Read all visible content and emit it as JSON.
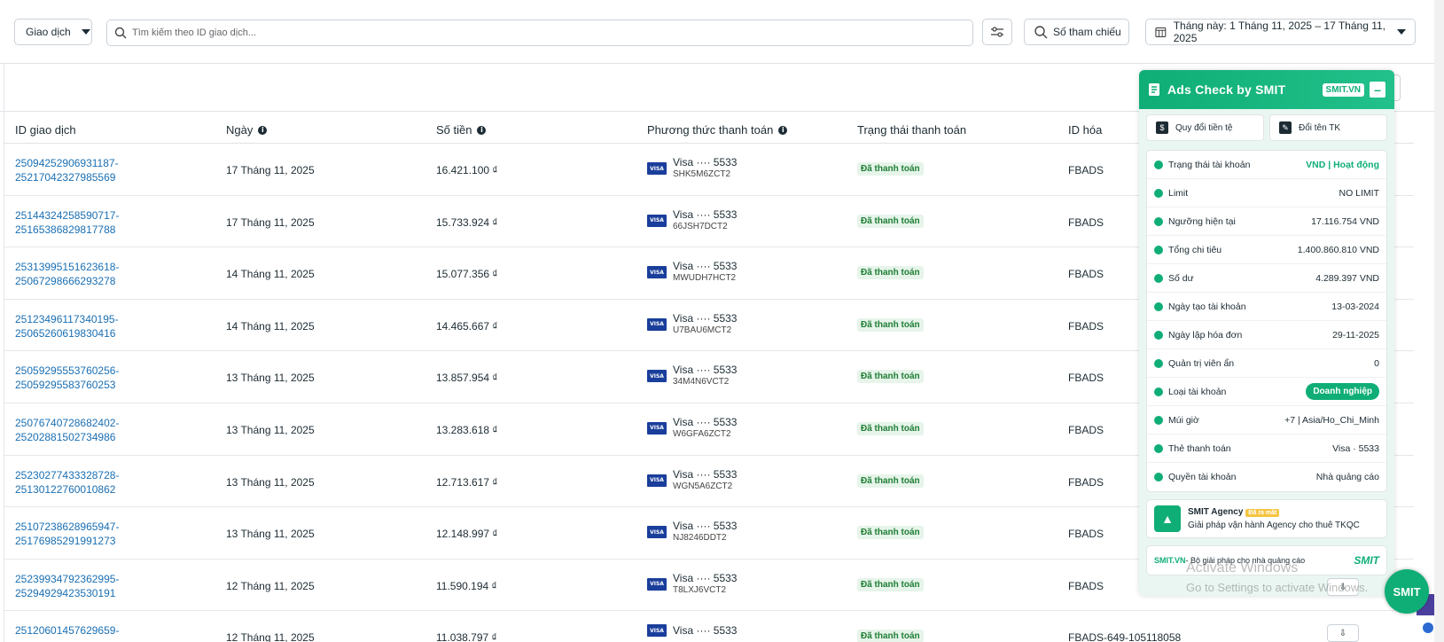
{
  "filters": {
    "type_label": "Giao dịch",
    "search_placeholder": "Tìm kiếm theo ID giao dịch...",
    "reference_label": "Số tham chiếu",
    "date_range_label": "Tháng này: 1 Tháng 11, 2025 – 17 Tháng 11, 2025"
  },
  "table": {
    "headers": {
      "id": "ID giao dịch",
      "date": "Ngày",
      "amount": "Số tiền",
      "payment": "Phương thức thanh toán",
      "status": "Trạng thái thanh toán",
      "invoice": "ID hóa"
    },
    "rows": [
      {
        "id1": "25094252906931187-",
        "id2": "25217042327985569",
        "date": "17 Tháng 11, 2025",
        "amount": "16.421.100 ₫",
        "card": "Visa ···· 5533",
        "code": "SHK5M6ZCT2",
        "status": "Đã thanh toán",
        "invoice": "FBADS"
      },
      {
        "id1": "25144324258590717-",
        "id2": "25165386829817788",
        "date": "17 Tháng 11, 2025",
        "amount": "15.733.924 ₫",
        "card": "Visa ···· 5533",
        "code": "66JSH7DCT2",
        "status": "Đã thanh toán",
        "invoice": "FBADS"
      },
      {
        "id1": "25313995151623618-",
        "id2": "25067298666293278",
        "date": "14 Tháng 11, 2025",
        "amount": "15.077.356 ₫",
        "card": "Visa ···· 5533",
        "code": "MWUDH7HCT2",
        "status": "Đã thanh toán",
        "invoice": "FBADS"
      },
      {
        "id1": "25123496117340195-",
        "id2": "25065260619830416",
        "date": "14 Tháng 11, 2025",
        "amount": "14.465.667 ₫",
        "card": "Visa ···· 5533",
        "code": "U7BAU6MCT2",
        "status": "Đã thanh toán",
        "invoice": "FBADS"
      },
      {
        "id1": "25059295553760256-",
        "id2": "25059295583760253",
        "date": "13 Tháng 11, 2025",
        "amount": "13.857.954 ₫",
        "card": "Visa ···· 5533",
        "code": "34M4N6VCT2",
        "status": "Đã thanh toán",
        "invoice": "FBADS"
      },
      {
        "id1": "25076740728682402-",
        "id2": "25202881502734986",
        "date": "13 Tháng 11, 2025",
        "amount": "13.283.618 ₫",
        "card": "Visa ···· 5533",
        "code": "W6GFA6ZCT2",
        "status": "Đã thanh toán",
        "invoice": "FBADS"
      },
      {
        "id1": "25230277433328728-",
        "id2": "25130122760010862",
        "date": "13 Tháng 11, 2025",
        "amount": "12.713.617 ₫",
        "card": "Visa ···· 5533",
        "code": "WGN5A6ZCT2",
        "status": "Đã thanh toán",
        "invoice": "FBADS"
      },
      {
        "id1": "25107238628965947-",
        "id2": "25176985291991273",
        "date": "13 Tháng 11, 2025",
        "amount": "12.148.997 ₫",
        "card": "Visa ···· 5533",
        "code": "NJ8246DDT2",
        "status": "Đã thanh toán",
        "invoice": "FBADS"
      },
      {
        "id1": "25239934792362995-",
        "id2": "25294929423530191",
        "date": "12 Tháng 11, 2025",
        "amount": "11.590.194 ₫",
        "card": "Visa ···· 5533",
        "code": "T8LXJ6VCT2",
        "status": "Đã thanh toán",
        "invoice": "FBADS"
      },
      {
        "id1": "25120601457629659-",
        "id2": "",
        "date": "12 Tháng 11, 2025",
        "amount": "11.038.797 ₫",
        "card": "Visa ···· 5533",
        "code": "",
        "status": "Đã thanh toán",
        "invoice": "FBADS-649-105118058"
      }
    ]
  },
  "panel": {
    "title": "Ads Check by SMIT",
    "badge": "SMIT.VN",
    "minimize": "–",
    "btn_currency": "Quy đổi tiền tệ",
    "btn_rename": "Đổi tên TK",
    "fields": [
      {
        "label": "Trạng thái tài khoản",
        "value": "VND | Hoạt động"
      },
      {
        "label": "Limit",
        "value": "NO LIMIT"
      },
      {
        "label": "Ngưỡng hiện tại",
        "value": "17.116.754 VND"
      },
      {
        "label": "Tổng chi tiêu",
        "value": "1.400.860.810 VND"
      },
      {
        "label": "Số dư",
        "value": "4.289.397 VND"
      },
      {
        "label": "Ngày tạo tài khoản",
        "value": "13-03-2024"
      },
      {
        "label": "Ngày lập hóa đơn",
        "value": "29-11-2025"
      },
      {
        "label": "Quản trị viên ẩn",
        "value": "0"
      },
      {
        "label": "Loại tài khoản",
        "value": "Doanh nghiệp"
      },
      {
        "label": "Múi giờ",
        "value": "+7 | Asia/Ho_Chi_Minh"
      },
      {
        "label": "Thẻ thanh toán",
        "value": "Visa · 5533"
      },
      {
        "label": "Quyền tài khoản",
        "value": "Nhà quảng cáo"
      }
    ],
    "agency_name": "SMIT Agency",
    "agency_badge": "Đã ra mắt",
    "agency_desc": "Giải pháp vận hành Agency cho thuê TKQC",
    "footer_site": "SMIT.VN",
    "footer_text": " - Bộ giải pháp cho nhà quảng cáo",
    "footer_logo": "SMIT"
  },
  "watermark": {
    "line1": "Activate Windows",
    "line2": "Go to Settings to activate Windows."
  },
  "fab_label": "SMIT"
}
